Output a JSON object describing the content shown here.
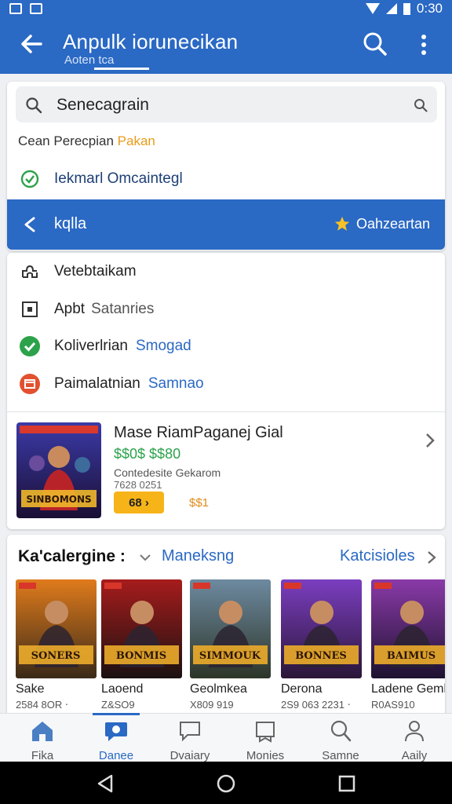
{
  "status_bar": {
    "time": "0:30"
  },
  "app_bar": {
    "title": "Anpulk iorunecikan",
    "subtitle": "Aoten   tca"
  },
  "search": {
    "query": "Senecagrain",
    "recent_label_prefix": "Cean Perecpian",
    "recent_label_highlight": "Pakan",
    "recent_item": "Iekmarl Omcaintegl"
  },
  "selected_row": {
    "label": "kqlla",
    "action": "Oahzeartan"
  },
  "menu": [
    {
      "label": "Vetebtaikam",
      "extra": "",
      "icon": "puzzle-icon"
    },
    {
      "label": "Apbt",
      "extra": "Satanries",
      "icon": "box-icon"
    },
    {
      "label": "Koliverlrian",
      "extra": "Smogad",
      "icon": "check-circle-icon"
    },
    {
      "label": "Paimalatnian",
      "extra": "Samnao",
      "icon": "calendar-icon"
    }
  ],
  "feature": {
    "title": "Mase RiamPaganej Gial",
    "price": "$$0$ $$80",
    "sub1": "Contedesite Gekarom",
    "sub2": "7628 0251",
    "badge": "68 ›",
    "rating": "$$1",
    "poster_title": "SINBOMONS"
  },
  "category": {
    "title": "Ka'calergine :",
    "link": "Maneksng",
    "more": "Katcisioles",
    "games": [
      {
        "name": "Sake",
        "meta": "2584 8OR ⋅",
        "art": "SONERS",
        "c1": "#e07b1c",
        "c2": "#3a2a18"
      },
      {
        "name": "Laoend",
        "meta": "Z&SO9",
        "art": "BONMIS",
        "c1": "#a71c1c",
        "c2": "#1b1111"
      },
      {
        "name": "Geolmkea",
        "meta": "X809 919",
        "art": "SIMMOUK",
        "c1": "#6d8aa0",
        "c2": "#2d3528"
      },
      {
        "name": "Derona",
        "meta": "2S9 063 2231 ⋅",
        "art": "BONNES",
        "c1": "#7b3ec0",
        "c2": "#2a1638"
      },
      {
        "name": "Ladene Gemb",
        "meta": "R0AS910",
        "art": "BAIMUS",
        "c1": "#8a3aa8",
        "c2": "#1d1230"
      }
    ]
  },
  "bottom_nav": [
    {
      "label": "Fika",
      "icon": "home-icon"
    },
    {
      "label": "Danee",
      "icon": "chat-bubble-icon"
    },
    {
      "label": "Dvaiary",
      "icon": "message-icon"
    },
    {
      "label": "Monies",
      "icon": "book-icon"
    },
    {
      "label": "Samne",
      "icon": "search-icon"
    },
    {
      "label": "Aaily",
      "icon": "person-icon"
    }
  ],
  "colors": {
    "primary": "#2a69c4",
    "accent": "#f6b418",
    "green": "#2ca24b"
  }
}
